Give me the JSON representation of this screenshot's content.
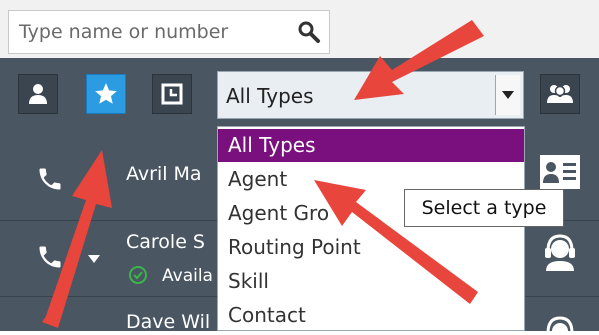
{
  "search": {
    "placeholder": "Type name or number"
  },
  "toolbar": {
    "buttons": [
      {
        "name": "person-icon",
        "active": false
      },
      {
        "name": "star-icon",
        "active": true
      },
      {
        "name": "history-icon",
        "active": false
      },
      {
        "name": "group-icon",
        "active": false
      }
    ],
    "type_filter": {
      "selected": "All Types"
    }
  },
  "dropdown": {
    "options": [
      "All Types",
      "Agent",
      "Agent Gro",
      "Routing Point",
      "Skill",
      "Contact"
    ],
    "selected_index": 0
  },
  "tooltip": {
    "text": "Select a type"
  },
  "contacts": [
    {
      "name": "Avril Ma",
      "status": ""
    },
    {
      "name": "Carole S",
      "status": "Availa"
    },
    {
      "name": "Dave Wil",
      "status": ""
    }
  ],
  "colors": {
    "toolbar_bg": "#4a5662",
    "active_button": "#2b9be2",
    "selected_option": "#7a0f7e",
    "annotation_arrow": "#e8453c",
    "status_available": "#3cb44b"
  }
}
